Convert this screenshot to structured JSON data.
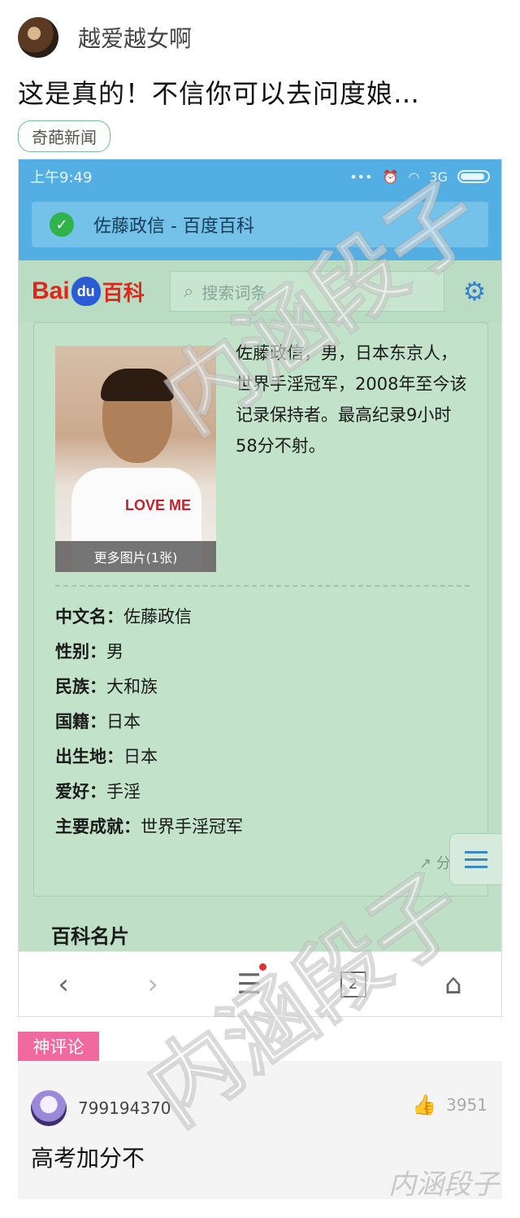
{
  "post": {
    "username": "越爱越女啊",
    "text": "这是真的！不信你可以去问度娘…",
    "tag": "奇葩新闻"
  },
  "phone": {
    "status_time": "上午9:49",
    "network": "3G",
    "page_title": "佐藤政信 - 百度百科",
    "logo": {
      "bai": "Bai",
      "du": "du",
      "baike": "百科"
    },
    "search_placeholder": "搜索词条",
    "card": {
      "photo_caption": "更多图片(1张)",
      "photo_shirt_text": "LOVE ME",
      "summary": "佐藤政信，男，日本东京人，世界手淫冠军，2008年至今该记录保持者。最高纪录9小时58分不射。",
      "info": [
        {
          "key": "中文名：",
          "value": "佐藤政信"
        },
        {
          "key": "性别：",
          "value": "男"
        },
        {
          "key": "民族：",
          "value": "大和族"
        },
        {
          "key": "国籍：",
          "value": "日本"
        },
        {
          "key": "出生地：",
          "value": "日本"
        },
        {
          "key": "爱好：",
          "value": "手淫"
        },
        {
          "key": "主要成就：",
          "value": "世界手淫冠军"
        }
      ],
      "share_label": "分享"
    },
    "section_title": "百科名片",
    "browser": {
      "tab_count": "2"
    }
  },
  "comment": {
    "label": "神评论",
    "user": "799194370",
    "likes": "3951",
    "text": "高考加分不"
  },
  "watermark": "内涵段子",
  "colors": {
    "status_blue": "#52aee3",
    "page_green": "#bfe0c6",
    "baidu_red": "#e0251b",
    "baidu_blue": "#2a5cd6",
    "hot_pink": "#f06aa0"
  }
}
